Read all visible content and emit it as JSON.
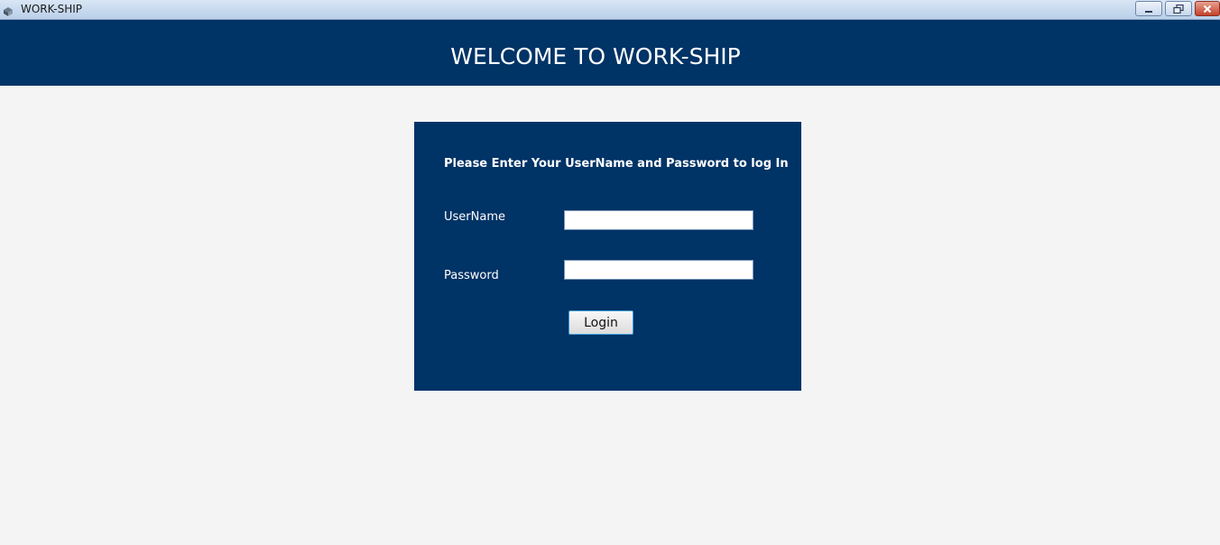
{
  "window": {
    "title": "WORK-SHIP",
    "icon": "ship-app-icon",
    "controls": {
      "minimize_icon": "minimize-icon",
      "restore_icon": "restore-icon",
      "close_icon": "close-icon"
    }
  },
  "header": {
    "title": "WELCOME TO WORK-SHIP",
    "background_color": "#003366"
  },
  "login_panel": {
    "instruction": "Please Enter Your UserName and Password to log In",
    "username": {
      "label": "UserName",
      "value": ""
    },
    "password": {
      "label": "Password",
      "value": ""
    },
    "login_label": "Login",
    "background_color": "#003366"
  },
  "colors": {
    "page_background": "#f4f4f4",
    "button_focus_border": "#3c9bd8"
  }
}
